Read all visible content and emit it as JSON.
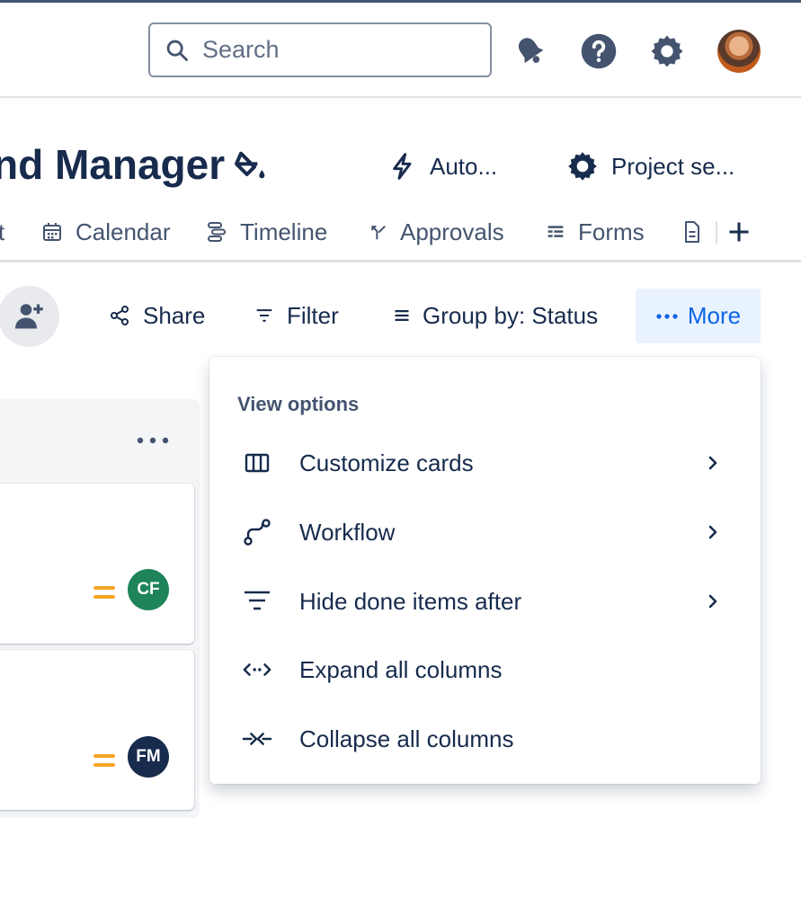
{
  "topnav": {
    "search": {
      "placeholder": "Search",
      "value": ""
    },
    "icons": [
      "notifications-icon",
      "help-icon",
      "settings-icon",
      "profile-avatar"
    ]
  },
  "project": {
    "title": "nd Manager",
    "automation_label": "Auto...",
    "settings_label": "Project se..."
  },
  "tabs": [
    {
      "label": "t",
      "icon": "list-icon"
    },
    {
      "label": "Calendar",
      "icon": "calendar-icon"
    },
    {
      "label": "Timeline",
      "icon": "timeline-icon"
    },
    {
      "label": "Approvals",
      "icon": "approvals-icon"
    },
    {
      "label": "Forms",
      "icon": "forms-icon"
    },
    {
      "label": "",
      "icon": "page-icon"
    }
  ],
  "toolbar": {
    "share_label": "Share",
    "filter_label": "Filter",
    "group_label": "Group by: Status",
    "more_label": "More"
  },
  "board": {
    "cards": [
      {
        "priority": "medium",
        "assignee_initials": "CF",
        "assignee_color": "#1f845a"
      },
      {
        "priority": "medium",
        "assignee_initials": "FM",
        "assignee_color": "#172b4d"
      }
    ]
  },
  "dropdown": {
    "heading": "View options",
    "items": [
      {
        "label": "Customize cards",
        "icon": "columns-icon",
        "has_submenu": true
      },
      {
        "label": "Workflow",
        "icon": "workflow-icon",
        "has_submenu": true
      },
      {
        "label": "Hide done items after",
        "icon": "filter-icon",
        "has_submenu": true
      },
      {
        "label": "Expand all columns",
        "icon": "expand-icon",
        "has_submenu": false
      },
      {
        "label": "Collapse all columns",
        "icon": "collapse-icon",
        "has_submenu": false
      }
    ]
  },
  "colors": {
    "text_primary": "#172b4d",
    "text_subtle": "#44546f",
    "accent": "#0c66e4",
    "accent_bg": "#e9f2ff",
    "priority_medium": "#f5a623"
  }
}
